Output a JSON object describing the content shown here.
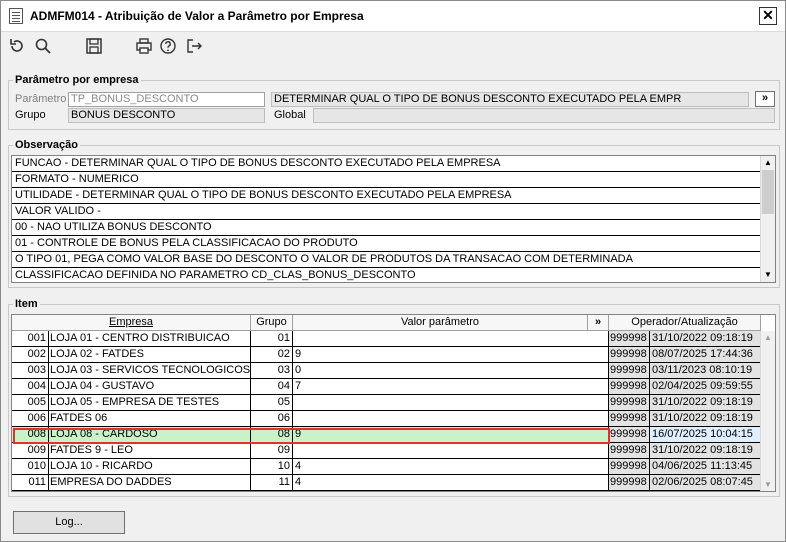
{
  "window": {
    "title": "ADMFM014 - Atribuição de Valor a Parâmetro por Empresa",
    "close_label": "✕"
  },
  "toolbar": {
    "icons": [
      "undo-icon",
      "search-icon",
      "save-icon",
      "print-icon",
      "help-icon",
      "exit-icon"
    ]
  },
  "param_section": {
    "legend": "Parâmetro por empresa",
    "parametro_label": "Parâmetro",
    "parametro_value": "TP_BONUS_DESCONTO",
    "descricao_value": "DETERMINAR QUAL O TIPO DE BONUS DESCONTO EXECUTADO PELA EMPR",
    "expand_label": "»",
    "grupo_label": "Grupo",
    "grupo_value": "BONUS DESCONTO",
    "global_label": "Global",
    "global_value": ""
  },
  "obs_section": {
    "legend": "Observação",
    "lines": [
      "FUNCAO - DETERMINAR QUAL O TIPO DE BONUS DESCONTO EXECUTADO PELA EMPRESA",
      "FORMATO - NUMERICO",
      "UTILIDADE - DETERMINAR QUAL O TIPO DE BONUS DESCONTO EXECUTADO PELA EMPRESA",
      "VALOR VALIDO -",
      "00 -  NAO UTILIZA BONUS DESCONTO",
      "01 - CONTROLE DE BONUS PELA CLASSIFICACAO DO PRODUTO",
      " O TIPO 01, PEGA COMO VALOR BASE DO DESCONTO O VALOR DE PRODUTOS DA TRANSACAO COM DETERMINADA",
      " CLASSIFICACAO DEFINIDA NO PARAMETRO CD_CLAS_BONUS_DESCONTO"
    ]
  },
  "item_section": {
    "legend": "Item",
    "headers": {
      "empresa": "Empresa",
      "grupo": "Grupo",
      "valor": "Valor parâmetro",
      "expand": "»",
      "operador": "Operador/Atualização"
    },
    "rows": [
      {
        "code": "001",
        "name": "LOJA 01 - CENTRO DISTRIBUICAO",
        "grupo": "01",
        "valor": "",
        "operador": "999998",
        "data": "31/10/2022 09:18:19"
      },
      {
        "code": "002",
        "name": "LOJA 02 - FATDES",
        "grupo": "02",
        "valor": "9",
        "operador": "999998",
        "data": "08/07/2025 17:44:36"
      },
      {
        "code": "003",
        "name": "LOJA 03 - SERVICOS TECNOLOGICOS LTDA",
        "grupo": "03",
        "valor": "0",
        "operador": "999998",
        "data": "03/11/2023 08:10:19"
      },
      {
        "code": "004",
        "name": "LOJA 04 - GUSTAVO",
        "grupo": "04",
        "valor": "7",
        "operador": "999998",
        "data": "02/04/2025 09:59:55"
      },
      {
        "code": "005",
        "name": "LOJA 05 - EMPRESA DE TESTES",
        "grupo": "05",
        "valor": "",
        "operador": "999998",
        "data": "31/10/2022 09:18:19"
      },
      {
        "code": "006",
        "name": "FATDES 06",
        "grupo": "06",
        "valor": "",
        "operador": "999998",
        "data": "31/10/2022 09:18:19"
      },
      {
        "code": "008",
        "name": "LOJA 08 - CARDOSO",
        "grupo": "08",
        "valor": "9",
        "operador": "999998",
        "data": "16/07/2025 10:04:15"
      },
      {
        "code": "009",
        "name": "FATDES 9 - LEO",
        "grupo": "09",
        "valor": "",
        "operador": "999998",
        "data": "31/10/2022 09:18:19"
      },
      {
        "code": "010",
        "name": "LOJA 10 - RICARDO",
        "grupo": "10",
        "valor": "4",
        "operador": "999998",
        "data": "04/06/2025 11:13:45"
      },
      {
        "code": "011",
        "name": "EMPRESA DO DADDES",
        "grupo": "11",
        "valor": "4",
        "operador": "999998",
        "data": "02/06/2025 08:07:45"
      }
    ],
    "selected_index": 6
  },
  "footer": {
    "log_label": "Log..."
  }
}
